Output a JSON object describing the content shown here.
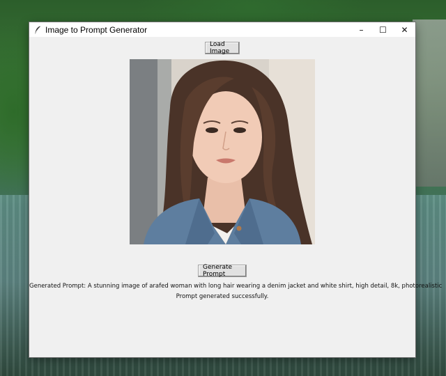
{
  "window": {
    "title": "Image to Prompt Generator",
    "controls": {
      "minimize": "–",
      "maximize": "☐",
      "close": "✕"
    }
  },
  "buttons": {
    "load_image": "Load Image",
    "generate_prompt": "Generate Prompt"
  },
  "output": {
    "generated_prompt": "Generated Prompt: A stunning image of arafed woman with long hair wearing a denim jacket and white shirt, high detail, 8k, photorealistic",
    "status": "Prompt generated successfully."
  },
  "icons": {
    "app": "feather-icon",
    "minimize": "minimize-icon",
    "maximize": "maximize-icon",
    "close": "close-icon"
  },
  "colors": {
    "window_bg": "#f0f0f0",
    "titlebar_bg": "#ffffff",
    "button_bg": "#e1e1e1"
  }
}
